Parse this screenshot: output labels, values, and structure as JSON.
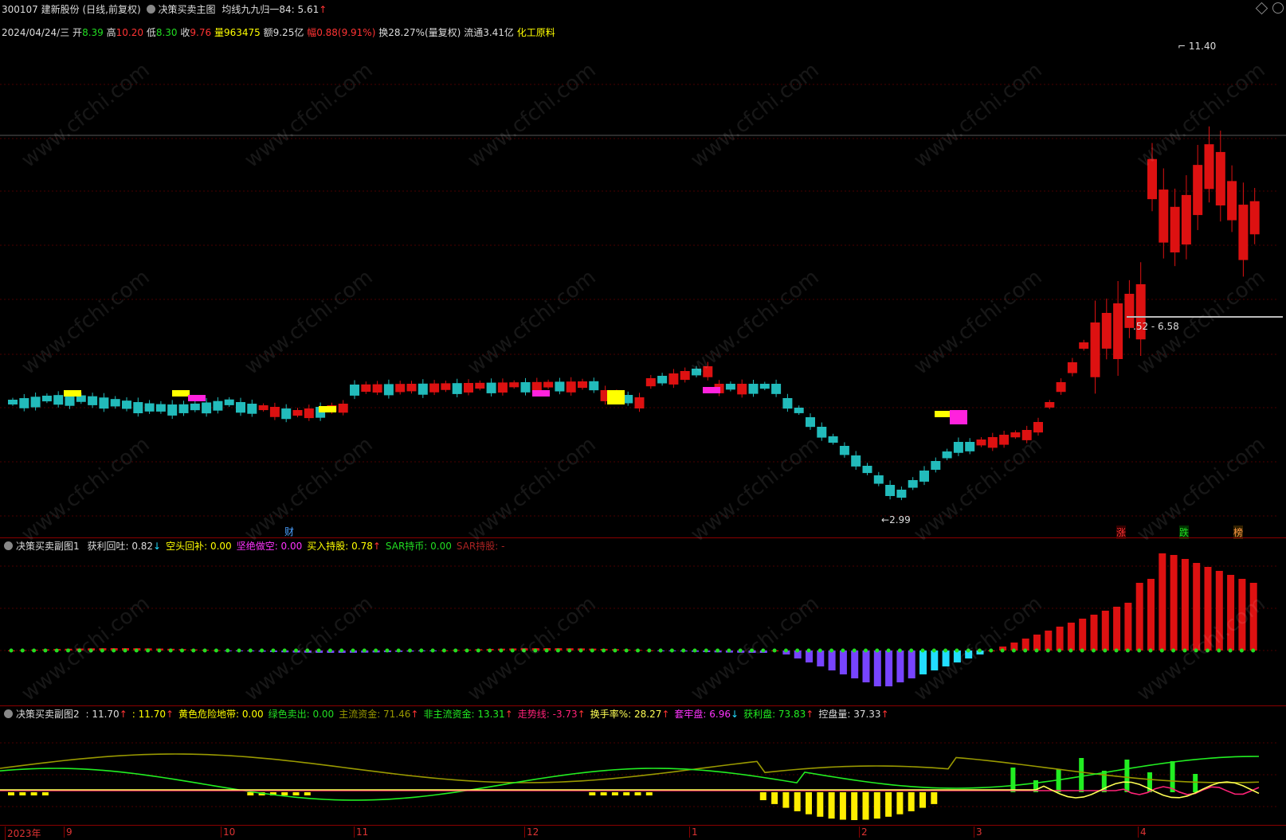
{
  "header": {
    "stock_code": "300107",
    "stock_name": "建新股份",
    "period": "(日线,前复权)",
    "indicator_name": "决策买卖主图",
    "ma_label": "均线九九归一84:",
    "ma_value": "5.61",
    "ma_arrow": "↑"
  },
  "quote": {
    "date": "2024/04/24/三",
    "open_label": "开",
    "open": "8.39",
    "high_label": "高",
    "high": "10.20",
    "low_label": "低",
    "low": "8.30",
    "close_label": "收",
    "close": "9.76",
    "vol_label": "量",
    "vol": "963475",
    "amount_label": "额",
    "amount": "9.25亿",
    "chg_label": "幅",
    "chg": "0.88(9.91%)",
    "turnover_label": "换",
    "turnover": "28.27%(量复权)",
    "float_label": "流通",
    "float": "3.41亿",
    "sector": "化工原料"
  },
  "main_chart": {
    "high_mark": "11.40",
    "low_mark": "2.99",
    "range_label": ".52 - 6.58",
    "event_cai": "财",
    "event_zhang": "涨",
    "event_die": "跌",
    "event_bang": "榜"
  },
  "sub1": {
    "title": "决策买卖副图1",
    "items": [
      {
        "label": "获利回吐:",
        "value": "0.82",
        "arrow": "↓",
        "color": "#dddddd",
        "arrow_color": "#22ddff"
      },
      {
        "label": "空头回补:",
        "value": "0.00",
        "arrow": "",
        "color": "#ffff00",
        "arrow_color": ""
      },
      {
        "label": "坚绝做空:",
        "value": "0.00",
        "arrow": "",
        "color": "#ff33ff",
        "arrow_color": ""
      },
      {
        "label": "买入持股:",
        "value": "0.78",
        "arrow": "↑",
        "color": "#ffff00",
        "arrow_color": "#ff3333"
      },
      {
        "label": "SAR持币:",
        "value": "0.00",
        "arrow": "",
        "color": "#22dd22",
        "arrow_color": ""
      },
      {
        "label": "SAR持股:",
        "value": "-",
        "arrow": "",
        "color": "#aa2222",
        "arrow_color": ""
      }
    ]
  },
  "sub2": {
    "title": "决策买卖副图2",
    "items": [
      {
        "label": ":",
        "value": "11.70",
        "arrow": "↑",
        "color": "#dddddd",
        "arrow_color": "#ff3333"
      },
      {
        "label": ":",
        "value": "11.70",
        "arrow": "↑",
        "color": "#ffff00",
        "arrow_color": "#ff3333"
      },
      {
        "label": "黄色危险地带:",
        "value": "0.00",
        "arrow": "",
        "color": "#ffff00",
        "arrow_color": ""
      },
      {
        "label": "绿色卖出:",
        "value": "0.00",
        "arrow": "",
        "color": "#22dd22",
        "arrow_color": ""
      },
      {
        "label": "主流资金:",
        "value": "71.46",
        "arrow": "↑",
        "color": "#999900",
        "arrow_color": "#ff3333"
      },
      {
        "label": "非主流资金:",
        "value": "13.31",
        "arrow": "↑",
        "color": "#22ee22",
        "arrow_color": "#ff3333"
      },
      {
        "label": "走势线:",
        "value": "-3.73",
        "arrow": "↑",
        "color": "#ff2277",
        "arrow_color": "#ff3333"
      },
      {
        "label": "换手率%:",
        "value": "28.27",
        "arrow": "↑",
        "color": "#ffff55",
        "arrow_color": "#ff3333"
      },
      {
        "label": "套牢盘:",
        "value": "6.96",
        "arrow": "↓",
        "color": "#ff33ff",
        "arrow_color": "#22ddff"
      },
      {
        "label": "获利盘:",
        "value": "73.83",
        "arrow": "↑",
        "color": "#22ee22",
        "arrow_color": "#ff3333"
      },
      {
        "label": "控盘量:",
        "value": "37.33",
        "arrow": "↑",
        "color": "#dddddd",
        "arrow_color": "#ff3333"
      }
    ]
  },
  "x_axis": {
    "labels": [
      "2023年",
      "9",
      "10",
      "11",
      "12",
      "1",
      "2",
      "3",
      "4"
    ]
  },
  "watermark": "www.cfchi.com",
  "colors": {
    "up": "#dd1111",
    "down": "#22bbbb",
    "grid": "#5a0000",
    "yellow_signal": "#ffff00",
    "magenta_signal": "#ff22dd"
  }
}
